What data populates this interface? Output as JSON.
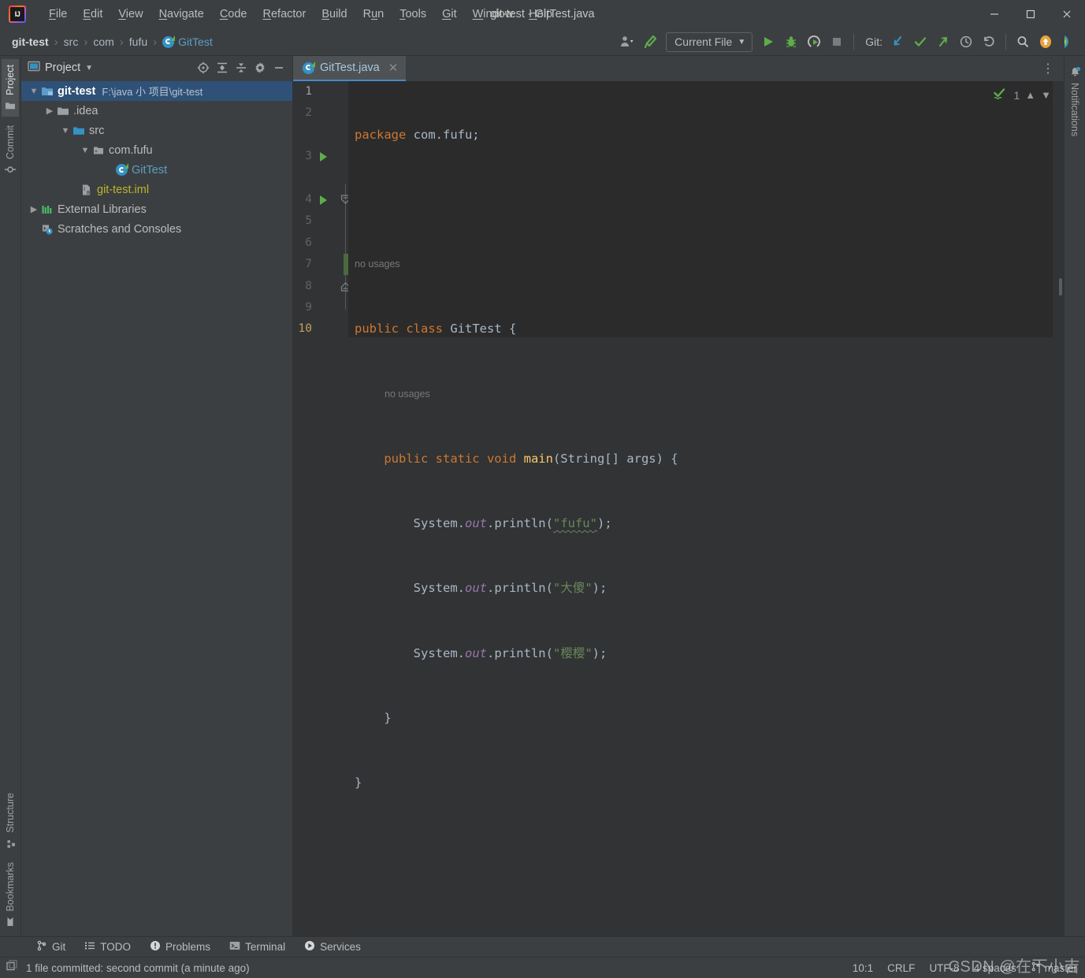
{
  "window": {
    "title": "git-test - GitTest.java",
    "logo_icon": "intellij-idea-logo",
    "minimize_icon": "minimize-icon",
    "maximize_icon": "maximize-icon",
    "close_icon": "close-icon"
  },
  "menubar": {
    "items": [
      {
        "label": "File",
        "mnemonic": "F"
      },
      {
        "label": "Edit",
        "mnemonic": "E"
      },
      {
        "label": "View",
        "mnemonic": "V"
      },
      {
        "label": "Navigate",
        "mnemonic": "N"
      },
      {
        "label": "Code",
        "mnemonic": "C"
      },
      {
        "label": "Refactor",
        "mnemonic": "R"
      },
      {
        "label": "Build",
        "mnemonic": "B"
      },
      {
        "label": "Run",
        "mnemonic": "u"
      },
      {
        "label": "Tools",
        "mnemonic": "T"
      },
      {
        "label": "Git",
        "mnemonic": "G"
      },
      {
        "label": "Window",
        "mnemonic": "W"
      },
      {
        "label": "Help",
        "mnemonic": "H"
      }
    ]
  },
  "navbar": {
    "breadcrumbs": [
      {
        "label": "git-test",
        "style": "bold"
      },
      {
        "label": "src",
        "style": "plain"
      },
      {
        "label": "com",
        "style": "plain"
      },
      {
        "label": "fufu",
        "style": "plain"
      },
      {
        "label": "GitTest",
        "style": "link",
        "icon": "java-class-icon"
      }
    ],
    "separator": "›",
    "run_config": "Current File",
    "git_label": "Git:",
    "icons": {
      "user_settings": "person-dropdown-icon",
      "build": "hammer-icon",
      "run": "run-triangle-icon",
      "debug": "debug-bug-icon",
      "coverage": "run-with-coverage-icon",
      "stop": "stop-square-icon",
      "git_update": "git-update-arrow-icon",
      "git_commit": "git-commit-check-icon",
      "git_push": "git-push-arrow-icon",
      "git_history": "git-history-clock-icon",
      "git_rollback": "git-rollback-icon",
      "search": "search-icon",
      "updates": "update-available-icon",
      "ide_feature": "ide-feature-icon"
    }
  },
  "left_strip": {
    "top": [
      {
        "label": "Project",
        "icon": "project-folder-icon",
        "active": true
      },
      {
        "label": "Commit",
        "icon": "commit-icon",
        "active": false
      }
    ],
    "bottom": [
      {
        "label": "Structure",
        "icon": "structure-icon",
        "active": false
      },
      {
        "label": "Bookmarks",
        "icon": "bookmark-icon",
        "active": false
      }
    ]
  },
  "right_strip": {
    "items": [
      {
        "label": "Notifications",
        "icon": "notification-bell-icon"
      }
    ]
  },
  "project_panel": {
    "title": "Project",
    "dropdown_icon": "chevron-down-icon",
    "tools": [
      {
        "name": "select-opened-file-icon",
        "glyph": "⊕"
      },
      {
        "name": "expand-all-icon",
        "glyph": "≡"
      },
      {
        "name": "collapse-all-icon",
        "glyph": "≡"
      },
      {
        "name": "settings-gear-icon",
        "glyph": "⚙"
      },
      {
        "name": "hide-panel-icon",
        "glyph": "—"
      }
    ],
    "tree": [
      {
        "label": "git-test",
        "path": "F:\\java 小 项目\\git-test",
        "indent": 0,
        "arrow": "down",
        "icon": "project-module-icon",
        "selected": true,
        "bold": true
      },
      {
        "label": ".idea",
        "path": "",
        "indent": 1,
        "arrow": "right",
        "icon": "folder-grey-icon",
        "selected": false,
        "bold": false
      },
      {
        "label": "src",
        "path": "",
        "indent": 1,
        "arrow": "down",
        "icon": "source-folder-icon",
        "selected": false,
        "bold": false
      },
      {
        "label": "com.fufu",
        "path": "",
        "indent": 2,
        "arrow": "down",
        "icon": "package-icon",
        "selected": false,
        "bold": false
      },
      {
        "label": "GitTest",
        "path": "",
        "indent": 3,
        "arrow": "none",
        "icon": "java-class-icon",
        "selected": false,
        "bold": false,
        "color": "#5b9ec7"
      },
      {
        "label": "git-test.iml",
        "path": "",
        "indent": 1,
        "arrow": "none",
        "icon": "iml-file-icon",
        "selected": false,
        "bold": false,
        "color": "#bbb529"
      },
      {
        "label": "External Libraries",
        "path": "",
        "indent": 0,
        "arrow": "right",
        "icon": "libraries-icon",
        "selected": false,
        "bold": false
      },
      {
        "label": "Scratches and Consoles",
        "path": "",
        "indent": 0,
        "arrow": "none",
        "icon": "scratches-icon",
        "selected": false,
        "bold": false
      }
    ]
  },
  "editor": {
    "tab": {
      "label": "GitTest.java",
      "icon": "java-class-icon",
      "close_icon": "close-icon",
      "active": true
    },
    "tabs_options_icon": "more-vertical-icon",
    "inspection": {
      "status_icon": "inspection-ok-icon",
      "count": "1",
      "up_icon": "chevron-up-icon",
      "down_icon": "chevron-down-icon"
    },
    "caret": {
      "line": 10,
      "column": 1
    },
    "lines": [
      {
        "num": 1,
        "tokens": [
          {
            "t": "package ",
            "c": "kw"
          },
          {
            "t": "com.fufu;",
            "c": "txt"
          }
        ]
      },
      {
        "num": 2,
        "tokens": []
      },
      {
        "num": 3,
        "tokens": [
          {
            "t": "public class ",
            "c": "kw"
          },
          {
            "t": "GitTest ",
            "c": "txt"
          },
          {
            "t": "{",
            "c": "txt"
          }
        ],
        "gutter_run": true,
        "hint": "no usages",
        "hint_indent": 0
      },
      {
        "num": 4,
        "tokens": [
          {
            "t": "    public static void ",
            "c": "kw"
          },
          {
            "t": "main",
            "c": "fn"
          },
          {
            "t": "(String[] args) {",
            "c": "txt"
          }
        ],
        "gutter_run": true,
        "hint": "no usages",
        "hint_indent": 4,
        "fold": true
      },
      {
        "num": 5,
        "tokens": [
          {
            "t": "        System.",
            "c": "txt"
          },
          {
            "t": "out",
            "c": "fld"
          },
          {
            "t": ".println(",
            "c": "txt"
          },
          {
            "t": "\"fufu\"",
            "c": "str",
            "typo": true
          },
          {
            "t": ");",
            "c": "txt"
          }
        ]
      },
      {
        "num": 6,
        "tokens": [
          {
            "t": "        System.",
            "c": "txt"
          },
          {
            "t": "out",
            "c": "fld"
          },
          {
            "t": ".println(",
            "c": "txt"
          },
          {
            "t": "\"大傻\"",
            "c": "str"
          },
          {
            "t": ");",
            "c": "txt"
          }
        ]
      },
      {
        "num": 7,
        "tokens": [
          {
            "t": "        System.",
            "c": "txt"
          },
          {
            "t": "out",
            "c": "fld"
          },
          {
            "t": ".println(",
            "c": "txt"
          },
          {
            "t": "\"樱樱\"",
            "c": "str"
          },
          {
            "t": ");",
            "c": "txt"
          }
        ],
        "changed": true
      },
      {
        "num": 8,
        "tokens": [
          {
            "t": "    }",
            "c": "txt"
          }
        ],
        "fold_end": true
      },
      {
        "num": 9,
        "tokens": [
          {
            "t": "}",
            "c": "txt"
          }
        ]
      },
      {
        "num": 10,
        "tokens": [],
        "active": true
      }
    ]
  },
  "bottom_tabs": [
    {
      "label": "Git",
      "icon": "git-branch-icon"
    },
    {
      "label": "TODO",
      "icon": "todo-list-icon"
    },
    {
      "label": "Problems",
      "icon": "problems-icon"
    },
    {
      "label": "Terminal",
      "icon": "terminal-icon"
    },
    {
      "label": "Services",
      "icon": "services-icon"
    }
  ],
  "statusbar": {
    "icon": "event-log-icon",
    "message": "1 file committed: second commit (a minute ago)",
    "caret_position": "10:1",
    "line_separator": "CRLF",
    "encoding": "UTF-8",
    "indent": "4 spaces",
    "branch": "master",
    "branch_icon": "git-branch-icon"
  },
  "watermark": "CSDN @在下小吉",
  "colors": {
    "chrome": "#3c3f41",
    "editor_bg": "#2b2b2b",
    "gutter_bg": "#313335",
    "selection": "#2f5177",
    "accent_blue": "#4a88c7",
    "keyword": "#cc7832",
    "string": "#6a8759",
    "method": "#ffc66d",
    "field": "#9876aa",
    "text": "#a9b7c6",
    "green_run": "#5ead4b"
  }
}
